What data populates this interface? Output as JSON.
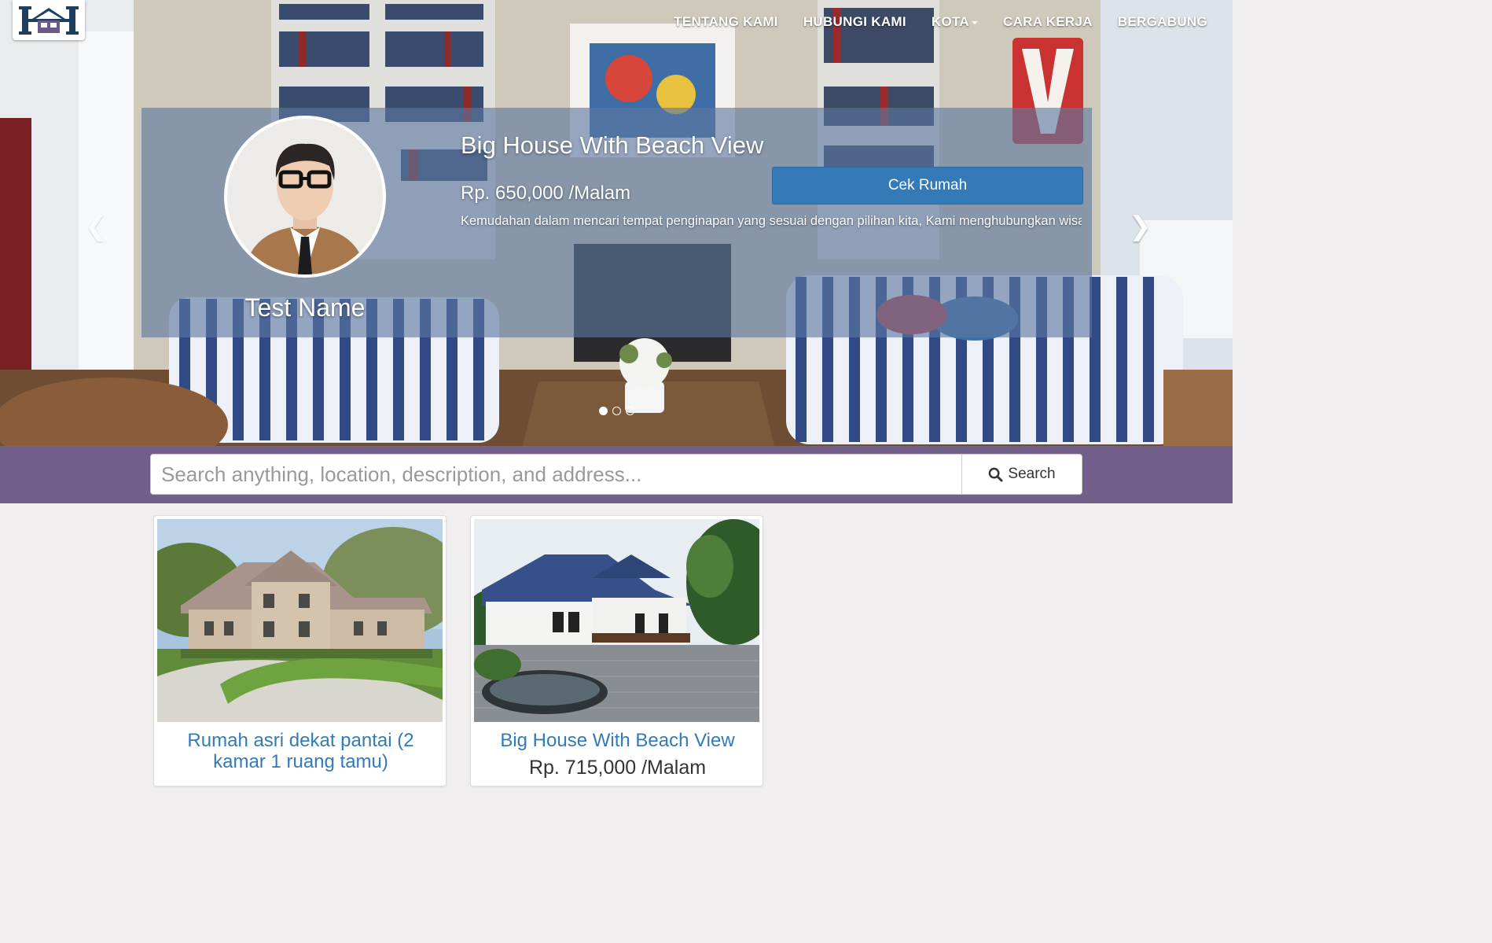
{
  "brand": {
    "logo_letter": "H"
  },
  "nav": {
    "items": [
      {
        "label": "TENTANG KAMI"
      },
      {
        "label": "HUBUNGI KAMI"
      },
      {
        "label": "KOTA"
      },
      {
        "label": "CARA KERJA"
      },
      {
        "label": "BERGABUNG"
      }
    ]
  },
  "carousel": {
    "agent_name": "Test Name",
    "title": "Big House With Beach View",
    "price": "Rp. 650,000 /Malam",
    "cta_label": "Cek Rumah",
    "description": "Kemudahan dalam mencari tempat penginapan yang sesuai dengan pilihan kita, Kami menghubungkan wisatawan dengan lokal di batam Ingin mendaftarkan rumah anda di homestay batam?, ikuti langkah-langk",
    "prev_icon": "chevron-left-icon",
    "next_icon": "chevron-right-icon",
    "slide_count": 3,
    "active_slide": 1
  },
  "search": {
    "placeholder": "Search anything, location, description, and address...",
    "button_label": "Search",
    "icon": "search-icon"
  },
  "listings": [
    {
      "title": "Rumah asri dekat pantai (2 kamar 1 ruang tamu)",
      "price": ""
    },
    {
      "title": "Big House With Beach View",
      "price": "Rp. 715,000 /Malam"
    }
  ],
  "colors": {
    "search_band": "#735f8c",
    "caption_overlay": "rgba(92,120,160,0.62)",
    "primary_button": "#337ab7",
    "link": "#337ab7",
    "page_bg": "#f0eeef"
  }
}
